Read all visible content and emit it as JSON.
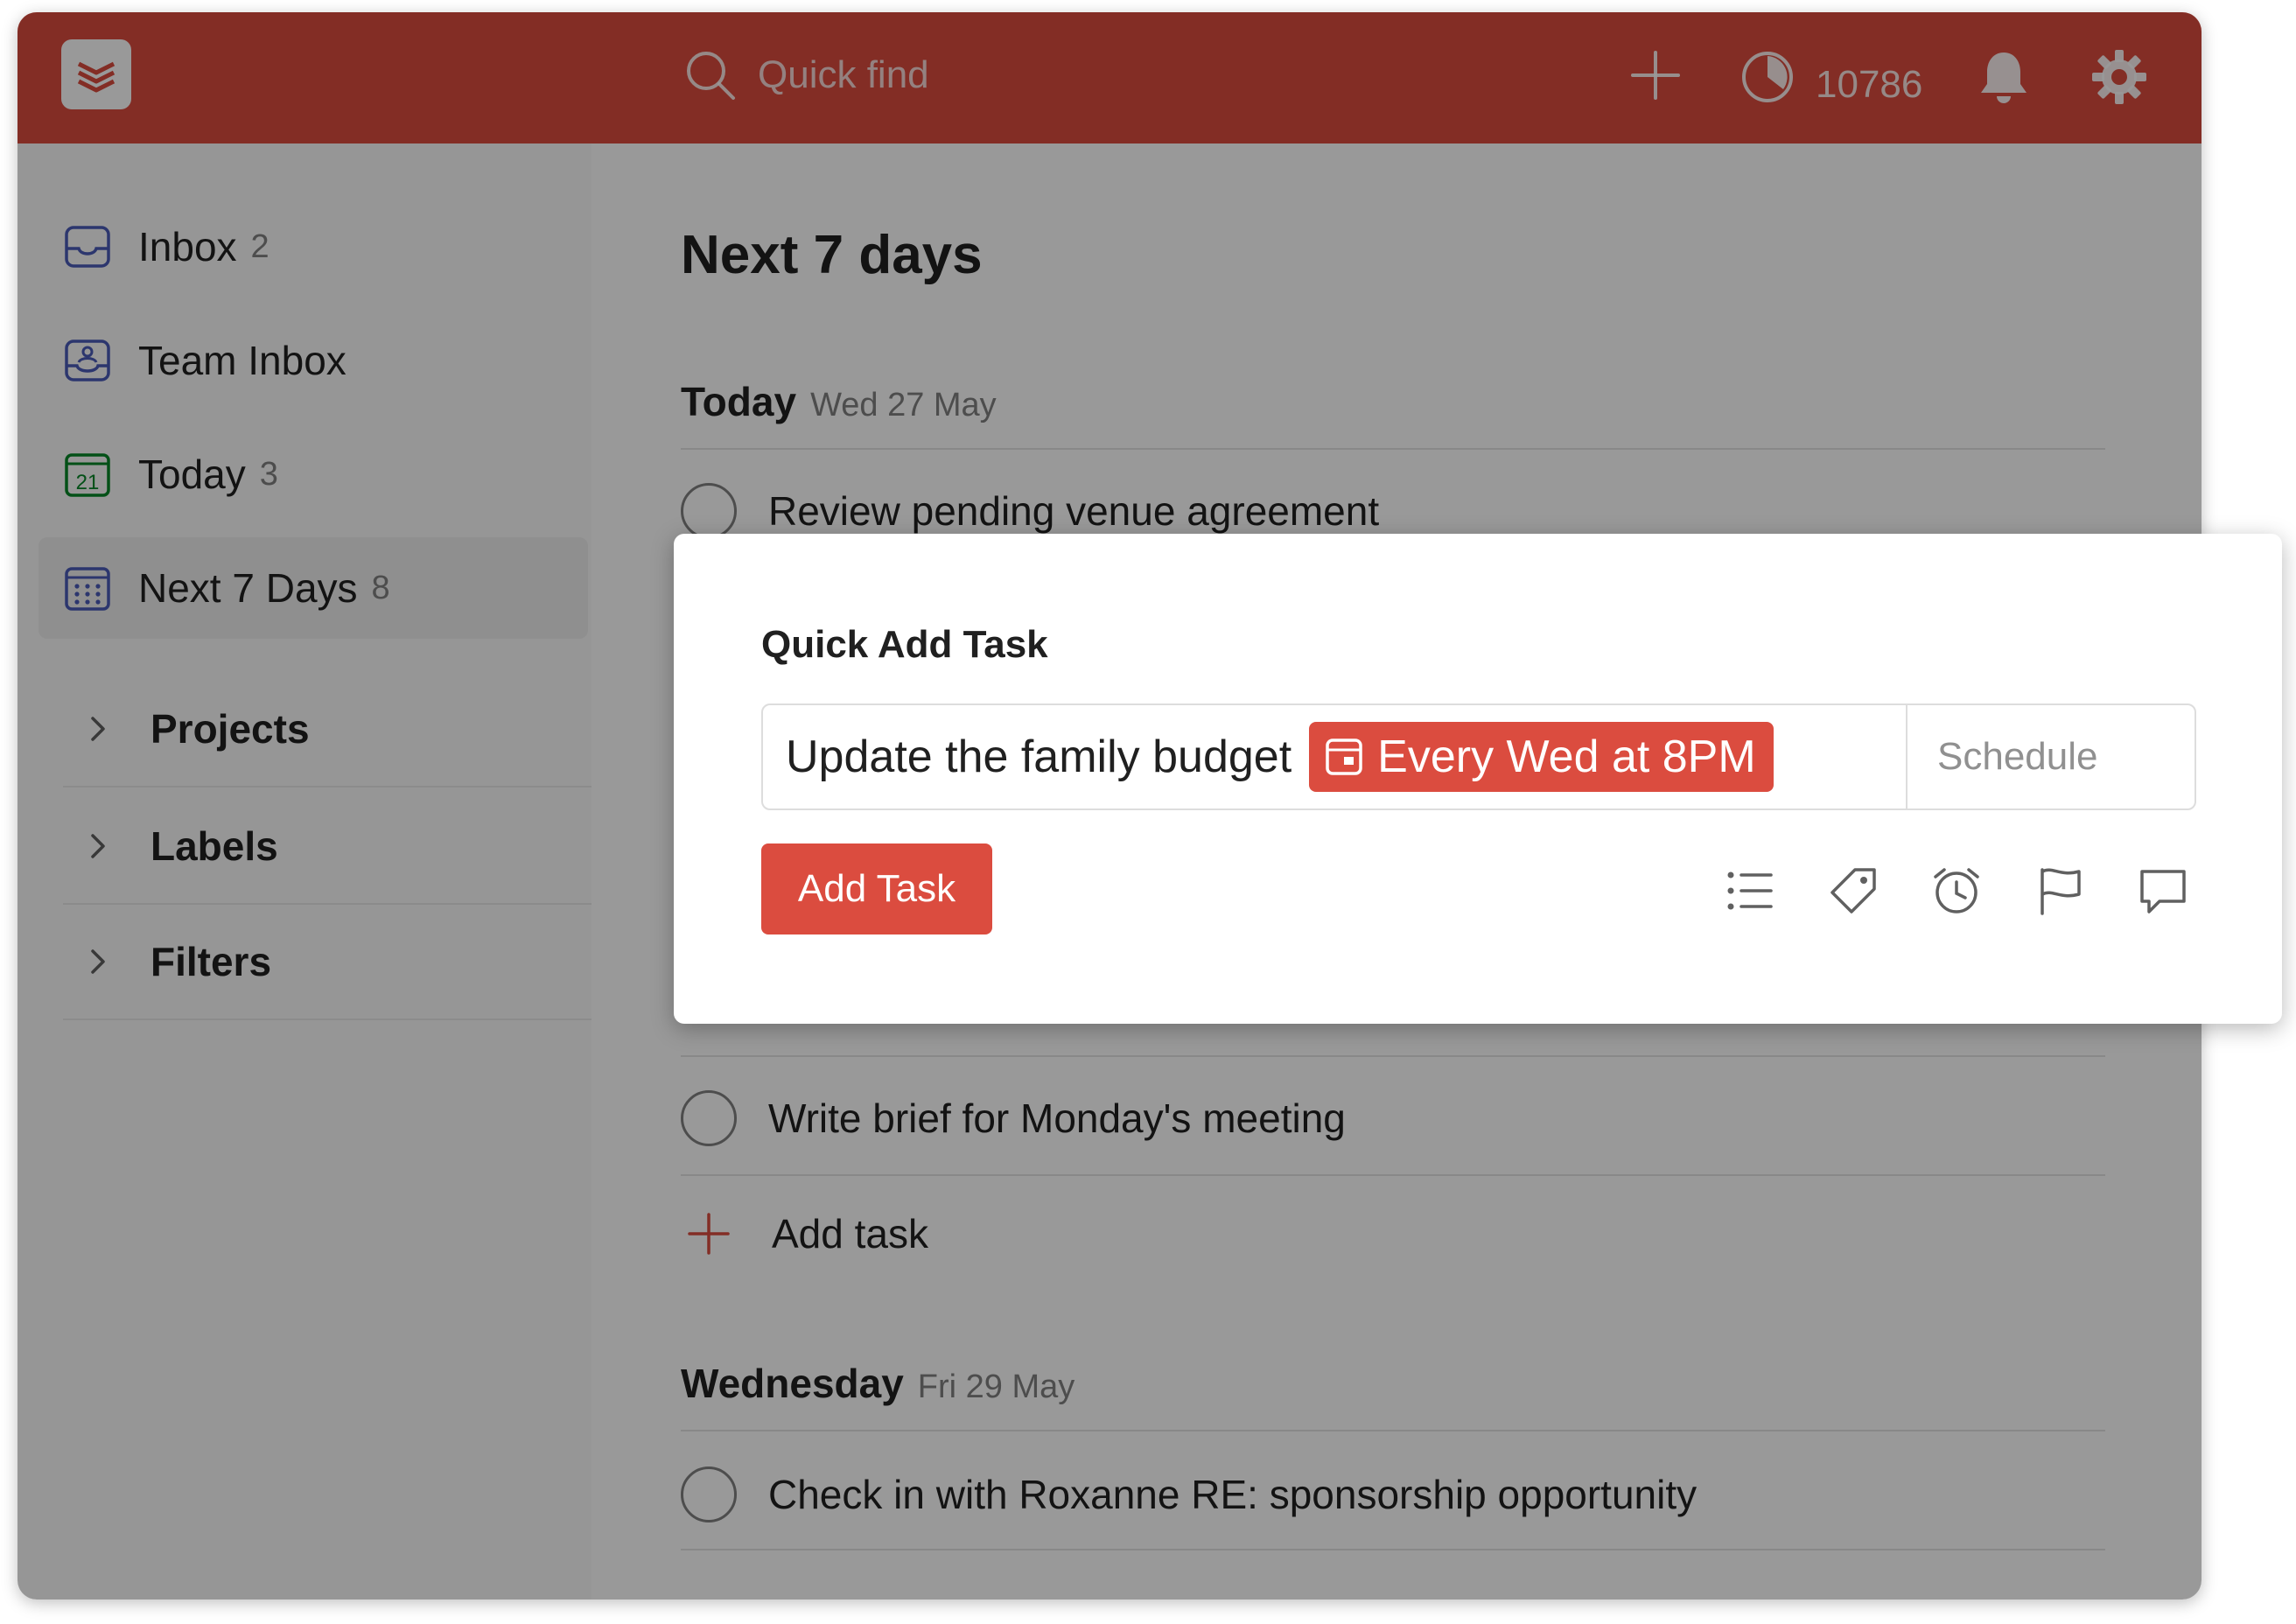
{
  "header": {
    "search_placeholder": "Quick find",
    "karma_points": "10786"
  },
  "sidebar": {
    "items": [
      {
        "label": "Inbox",
        "count": "2"
      },
      {
        "label": "Team Inbox",
        "count": ""
      },
      {
        "label": "Today",
        "count": "3",
        "icon_text": "21"
      },
      {
        "label": "Next 7 Days",
        "count": "8"
      }
    ],
    "sections": [
      {
        "label": "Projects"
      },
      {
        "label": "Labels"
      },
      {
        "label": "Filters"
      }
    ]
  },
  "main": {
    "title": "Next 7 days",
    "days": [
      {
        "name": "Today",
        "date": "Wed 27 May",
        "tasks": [
          "Review pending venue agreement",
          "Write brief for Monday's meeting"
        ],
        "add_task_label": "Add task"
      },
      {
        "name": "Wednesday",
        "date": "Fri 29 May",
        "tasks": [
          "Check in with Roxanne RE: sponsorship opportunity"
        ]
      }
    ]
  },
  "quick_add": {
    "title": "Quick Add Task",
    "task_text": "Update the family budget",
    "date_chip": "Every Wed at 8PM",
    "schedule_label": "Schedule",
    "add_button": "Add Task",
    "tools": [
      "project-list-icon",
      "label-tag-icon",
      "reminder-alarm-icon",
      "priority-flag-icon",
      "comment-icon"
    ]
  },
  "colors": {
    "brand": "#db4c3f",
    "overlay": "rgba(0,0,0,0.40)",
    "inbox_icon": "#4a5bb8",
    "today_icon": "#058527"
  }
}
